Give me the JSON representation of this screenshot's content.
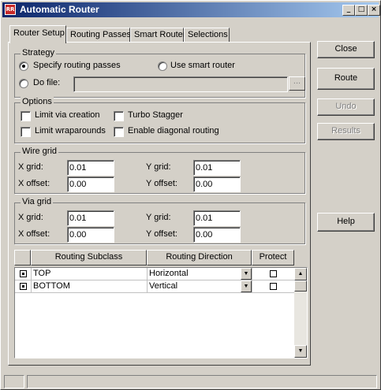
{
  "window": {
    "title": "Automatic Router",
    "app_icon_text": "RR",
    "minimize_glyph": "_",
    "maximize_glyph": "□",
    "close_glyph": "×"
  },
  "tabs": [
    {
      "label": "Router Setup",
      "active": true
    },
    {
      "label": "Routing Passes",
      "active": false
    },
    {
      "label": "Smart Router",
      "active": false
    },
    {
      "label": "Selections",
      "active": false
    }
  ],
  "strategy": {
    "title": "Strategy",
    "specify_label": "Specify routing passes",
    "smart_label": "Use smart router",
    "dofile_label": "Do file:",
    "dofile_value": "",
    "browse_label": "...",
    "selected": "specify"
  },
  "options": {
    "title": "Options",
    "limit_via_label": "Limit via creation",
    "turbo_label": "Turbo Stagger",
    "limit_wrap_label": "Limit wraparounds",
    "diagonal_label": "Enable diagonal routing",
    "limit_via": false,
    "turbo": false,
    "limit_wrap": false,
    "diagonal": false
  },
  "wire_grid": {
    "title": "Wire grid",
    "x_grid_label": "X grid:",
    "x_grid": "0.01",
    "y_grid_label": "Y grid:",
    "y_grid": "0.01",
    "x_offset_label": "X offset:",
    "x_offset": "0.00",
    "y_offset_label": "Y offset:",
    "y_offset": "0.00"
  },
  "via_grid": {
    "title": "Via grid",
    "x_grid_label": "X grid:",
    "x_grid": "0.01",
    "y_grid_label": "Y grid:",
    "y_grid": "0.01",
    "x_offset_label": "X offset:",
    "x_offset": "0.00",
    "y_offset_label": "Y offset:",
    "y_offset": "0.00"
  },
  "layer_table": {
    "headers": [
      "Routing Subclass",
      "Routing Direction",
      "Protect"
    ],
    "rows": [
      {
        "subclass": "TOP",
        "direction": "Horizontal",
        "protect": false
      },
      {
        "subclass": "BOTTOM",
        "direction": "Vertical",
        "protect": false
      }
    ],
    "dropdown_glyph": "▼",
    "scroll_up_glyph": "▲",
    "scroll_down_glyph": "▼"
  },
  "buttons": {
    "close": "Close",
    "route": "Route",
    "undo": "Undo",
    "results": "Results",
    "help": "Help"
  }
}
